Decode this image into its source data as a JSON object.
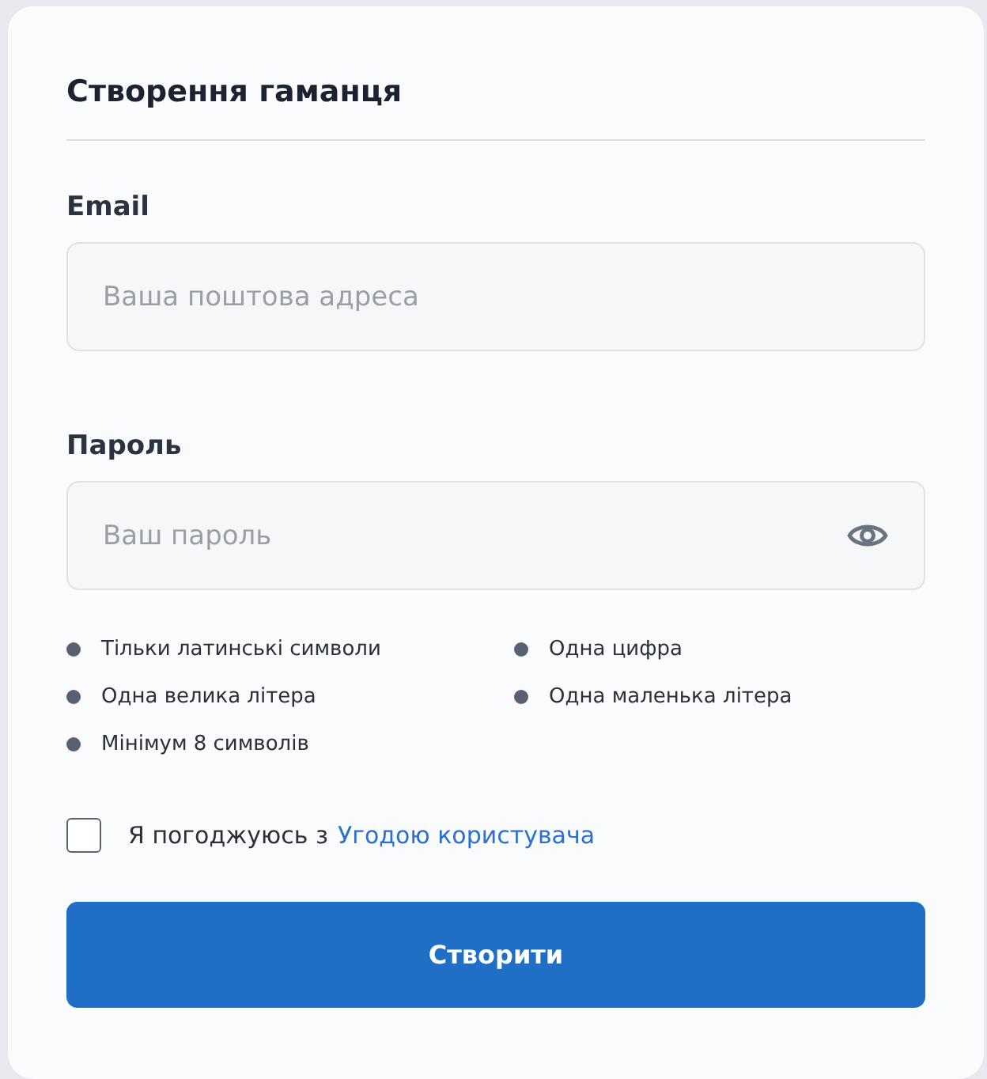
{
  "title": "Створення гаманця",
  "fields": [
    {
      "label": "Email",
      "placeholder": "Ваша поштова адреса",
      "kind": "email"
    },
    {
      "label": "Пароль",
      "placeholder": "Ваш пароль",
      "kind": "password"
    }
  ],
  "rules": [
    "Тільки латинські символи",
    "Одна цифра",
    "Одна велика літера",
    "Одна маленька літера",
    "Мінімум 8 символів"
  ],
  "agreement": {
    "text": "Я погоджуюсь з",
    "link": "Угодою користувача",
    "checked": false
  },
  "submit": "Створити"
}
